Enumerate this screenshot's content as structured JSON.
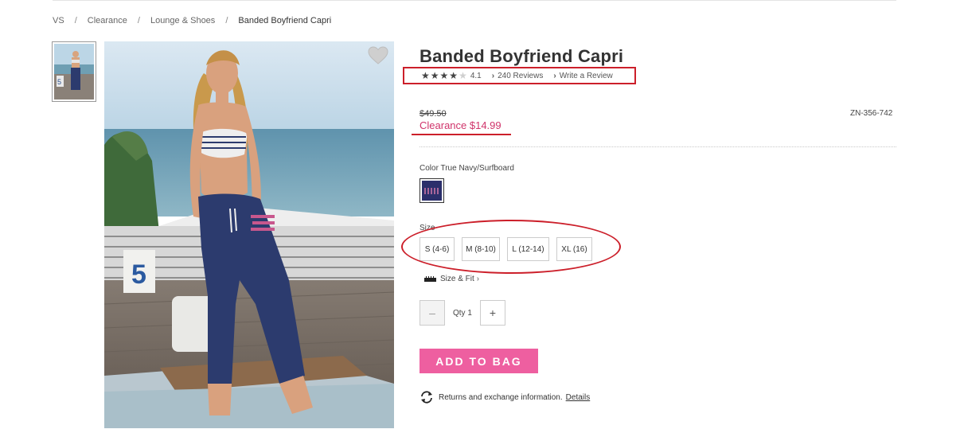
{
  "breadcrumb": [
    {
      "label": "VS"
    },
    {
      "label": "Clearance"
    },
    {
      "label": "Lounge & Shoes"
    },
    {
      "label": "Banded Boyfriend Capri"
    }
  ],
  "breadcrumb_separator": "/",
  "product": {
    "title": "Banded Boyfriend Capri",
    "rating": {
      "stars_filled": 4,
      "stars_total": 5,
      "value": "4.1"
    },
    "reviews_link": "240 Reviews",
    "write_review_link": "Write a Review",
    "original_price": "$49.50",
    "sale_price": "Clearance $14.99",
    "sku": "ZN-356-742",
    "color_label": "Color True Navy/Surfboard",
    "size_label": "Size",
    "sizes": [
      "S (4-6)",
      "M (8-10)",
      "L (12-14)",
      "XL (16)"
    ],
    "size_fit_link": "Size & Fit",
    "qty_label": "Qty 1",
    "qty_minus": "–",
    "qty_plus": "+",
    "add_to_bag": "ADD TO BAG",
    "returns_text": "Returns and exchange information.",
    "details_link": "Details"
  },
  "icons": {
    "favorite": "heart-icon",
    "chevron": "›",
    "star_filled": "★",
    "star_empty": "★",
    "ruler": "ruler-icon",
    "returns": "exchange-arrows-icon"
  },
  "colors": {
    "sale": "#d0346b",
    "add_to_bag": "#ee5fa0",
    "annotation": "#cc1f2a",
    "swatch": "#2b2f6b"
  }
}
